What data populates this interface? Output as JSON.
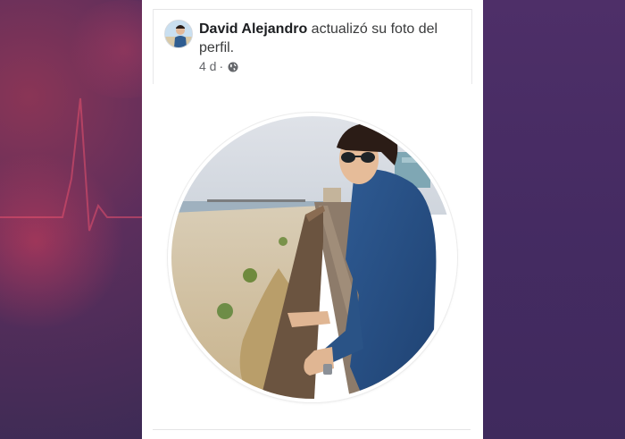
{
  "post": {
    "author": "David Alejandro",
    "action": " actualizó su foto del perfil.",
    "time": "4 d",
    "separator": "·",
    "privacy_icon": "globe-icon"
  },
  "profile_photo": {
    "avatar_icon": "avatar-icon",
    "image_subject": "profile-photo"
  },
  "colors": {
    "author": "#1c1e21",
    "text": "#3a3b3c",
    "meta": "#65676b",
    "card_bg": "#ffffff",
    "page_bg_left": "#5b2e5c",
    "page_bg_right": "#452b62"
  }
}
